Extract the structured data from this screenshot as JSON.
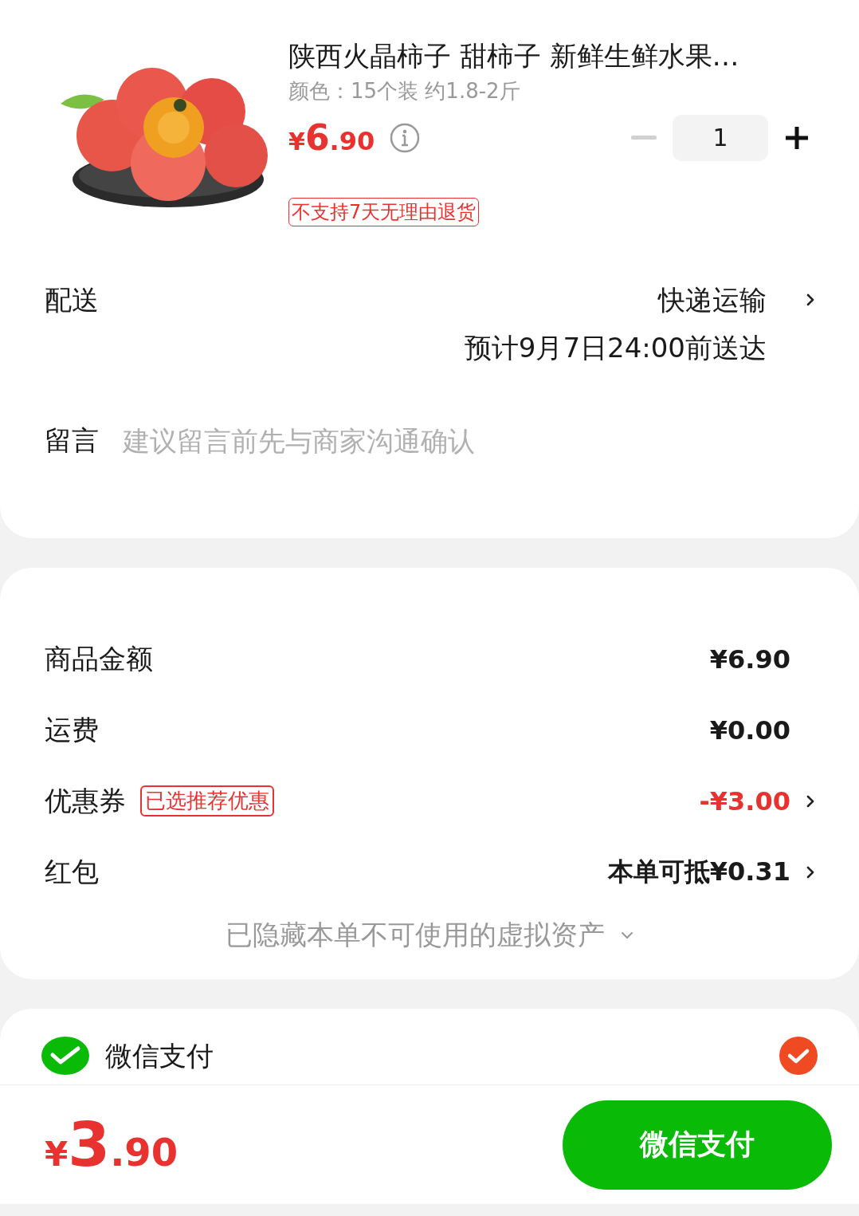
{
  "product": {
    "kind": "picture",
    "title": "陕西火晶柿子 甜柿子 新鲜生鲜水果…",
    "spec": "颜色：15个装 约1.8-2斤",
    "price": {
      "currency": "¥",
      "integer": "6",
      "fraction": ".90"
    },
    "quantity": "1",
    "minus_disabled": true,
    "tag": "不支持7天无理由退货"
  },
  "delivery": {
    "label": "配送",
    "method": "快递运输",
    "eta": "预计9月7日24:00前送达"
  },
  "message": {
    "label": "留言",
    "placeholder": "建议留言前先与商家沟通确认"
  },
  "summary": [
    {
      "kind": "plain",
      "label": "商品金额",
      "value": "¥6.90",
      "link": false
    },
    {
      "kind": "plain",
      "label": "运费",
      "value": "¥0.00",
      "link": false
    },
    {
      "kind": "discount",
      "label": "优惠券",
      "badge": "已选推荐优惠",
      "value": "-¥3.00",
      "link": true
    },
    {
      "kind": "plain",
      "label": "红包",
      "value": "本单可抵¥0.31",
      "link": true
    }
  ],
  "hidden_assets": "已隐藏本单不可使用的虚拟资产",
  "payment_methods": [
    {
      "label": "微信支付",
      "selected": true
    }
  ],
  "total": {
    "currency": "¥",
    "integer": "3",
    "fraction": ".90"
  },
  "pay_button": "微信支付"
}
